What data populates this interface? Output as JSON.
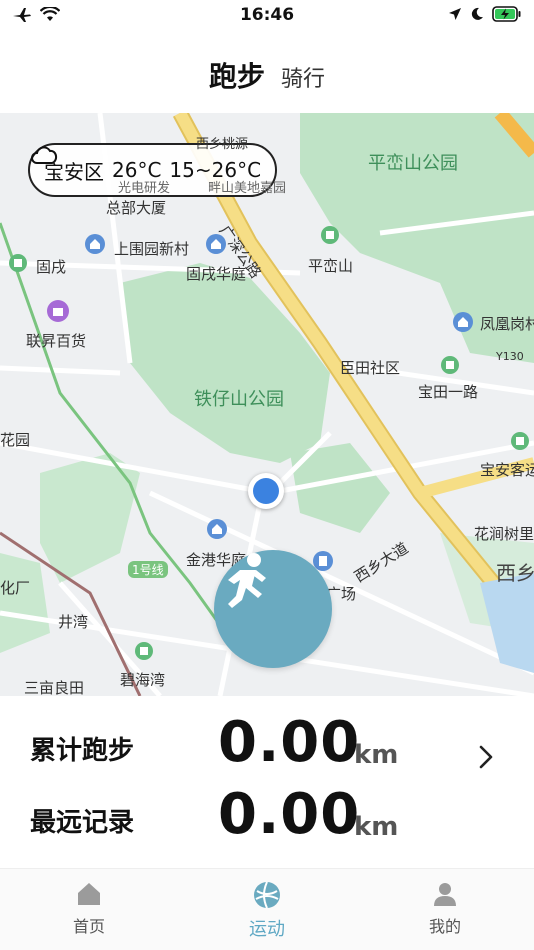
{
  "status_bar": {
    "time": "16:46"
  },
  "header": {
    "tabs": [
      {
        "label": "跑步"
      },
      {
        "label": "骑行"
      }
    ]
  },
  "map": {
    "weather": {
      "district": "宝安区",
      "temperature": "26°C",
      "range": "15~26°C"
    },
    "labels": {
      "pingluan_park": "平峦山公园",
      "tiezai_park": "铁仔山公园",
      "xixiang_taoyuan": "西乡桃源",
      "guangming_yanfa": "光电研发",
      "zongbu_dasha": "总部大厦",
      "meidi_jiayuan": "畔山美地嘉园",
      "guangshen_road": "广深公路",
      "shangwei": "上围园新村",
      "guxu": "固戌",
      "guxu_huating": "固戌华庭",
      "pingluanshan": "平峦山",
      "fenghuang": "凤凰岗村",
      "liansheng": "联昇百货",
      "y130": "Y130",
      "chentian": "臣田社区",
      "baotian": "宝田一路",
      "huayuan": "花园",
      "baoan_keyun": "宝安客运",
      "jingang": "金港华庭",
      "xixiang_dadao": "西乡大道",
      "huajian": "花涧树里",
      "xixiang": "西乡",
      "line1": "1号线",
      "guangchang": "广场",
      "huaguang": "化厂",
      "jingwan": "井湾",
      "bihaiwan": "碧海湾",
      "sanmu": "三亩良田"
    }
  },
  "stats": {
    "total": {
      "label": "累计跑步",
      "value": "0.00",
      "unit": "km"
    },
    "longest": {
      "label": "最远记录",
      "value": "0.00",
      "unit": "km"
    }
  },
  "bottom_nav": [
    {
      "label": "首页",
      "icon": "home-icon"
    },
    {
      "label": "运动",
      "icon": "sport-icon",
      "active": true
    },
    {
      "label": "我的",
      "icon": "profile-icon"
    }
  ],
  "colors": {
    "accent": "#5fa8c4",
    "run_button": "#6aaac0",
    "park_green": "#bfe3c6",
    "road_yellow": "#f6de86",
    "location_blue": "#3b82e0"
  }
}
